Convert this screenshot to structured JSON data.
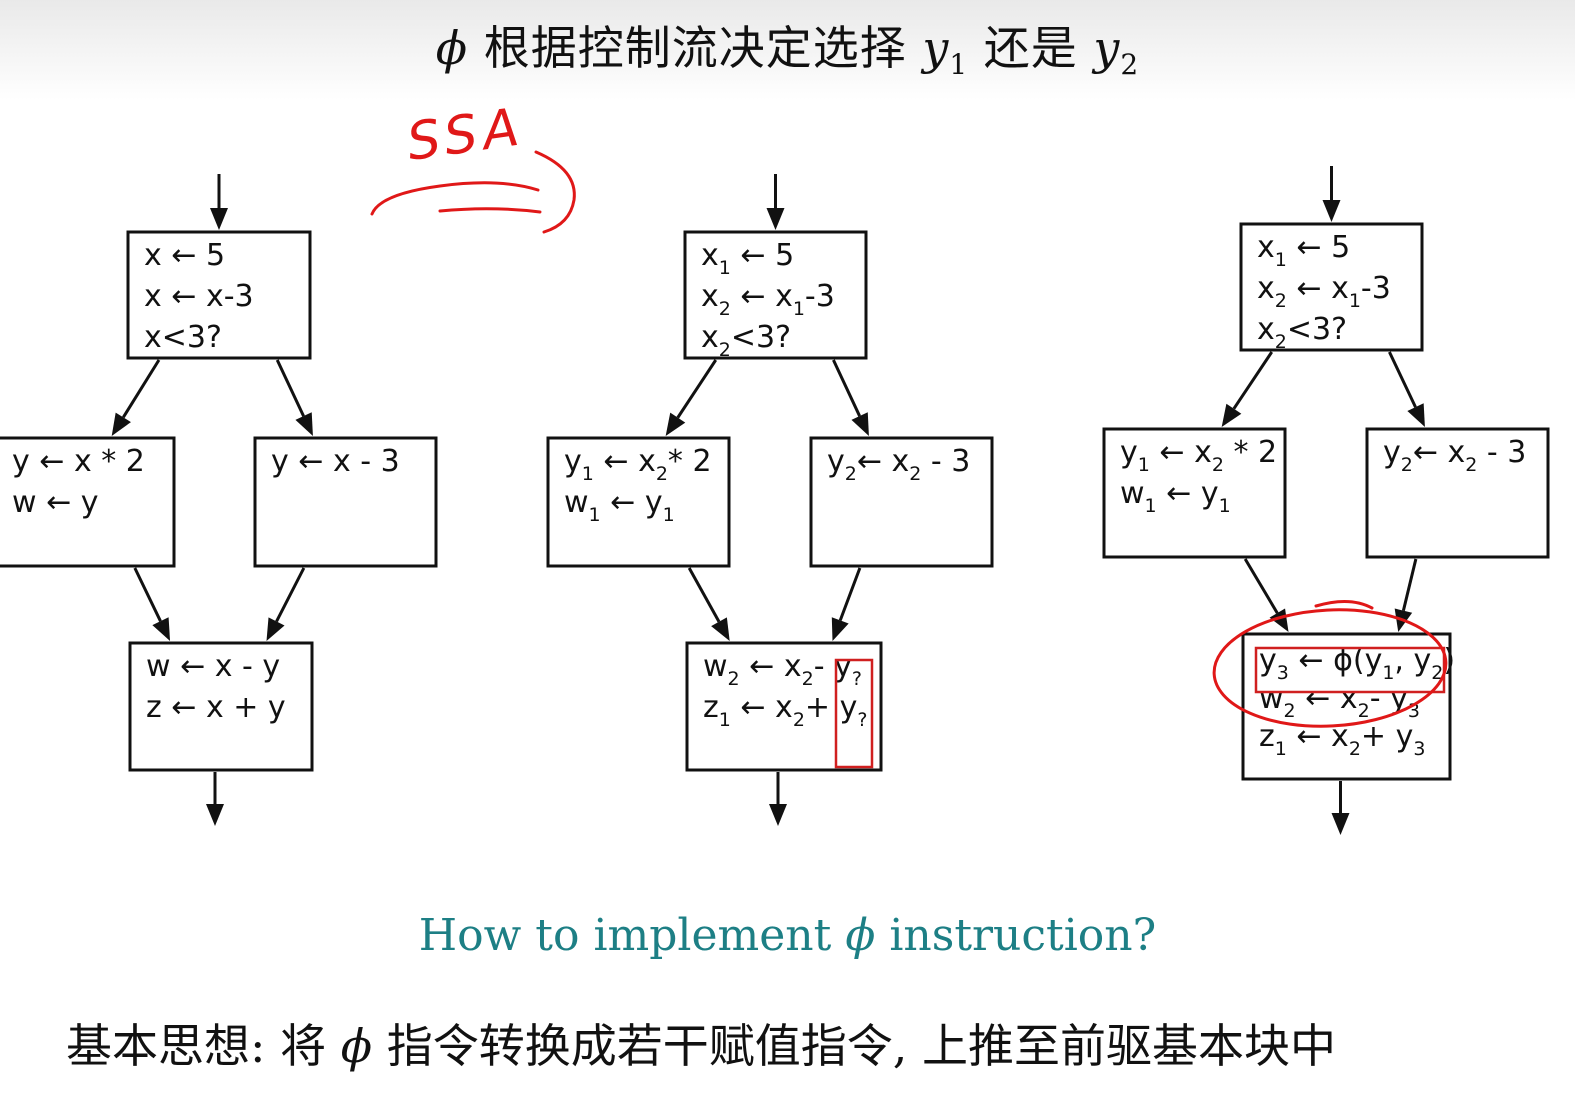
{
  "title": {
    "phi": "ϕ",
    "text": "根据控制流决定选择",
    "y": "y",
    "one": "1",
    "middle": "还是",
    "two": "2"
  },
  "annotation": {
    "ssa_label": "SSA"
  },
  "cfgs": [
    {
      "entry": [
        [
          {
            "t": "x"
          },
          {
            "t": " ← 5"
          }
        ],
        [
          {
            "t": "x"
          },
          {
            "t": " ← x-3"
          }
        ],
        [
          {
            "t": "  x<3?"
          }
        ]
      ],
      "left": [
        [
          {
            "t": "y ← x * 2"
          }
        ],
        [
          {
            "t": "w ← y"
          }
        ]
      ],
      "right": [
        [
          {
            "t": "y ← x - 3"
          }
        ]
      ],
      "join": [
        [
          {
            "t": "w ← x - y"
          }
        ],
        [
          {
            "t": " z ← x + y"
          }
        ]
      ]
    },
    {
      "entry": [
        [
          {
            "t": "x"
          },
          {
            "s": "1"
          },
          {
            "t": " ← 5"
          }
        ],
        [
          {
            "t": "x"
          },
          {
            "s": "2"
          },
          {
            "t": " ← x"
          },
          {
            "s": "1"
          },
          {
            "t": "-3"
          }
        ],
        [
          {
            "t": "  x"
          },
          {
            "s": "2"
          },
          {
            "t": "<3?"
          }
        ]
      ],
      "left": [
        [
          {
            "t": "y"
          },
          {
            "s": "1"
          },
          {
            "t": " ← x"
          },
          {
            "s": "2"
          },
          {
            "t": "* 2"
          }
        ],
        [
          {
            "t": "w"
          },
          {
            "s": "1"
          },
          {
            "t": " ← y"
          },
          {
            "s": "1"
          }
        ]
      ],
      "right": [
        [
          {
            "t": "y"
          },
          {
            "s": "2"
          },
          {
            "t": "← x"
          },
          {
            "s": "2"
          },
          {
            "t": " - 3"
          }
        ]
      ],
      "join": [
        [
          {
            "t": "w"
          },
          {
            "s": "2"
          },
          {
            "t": " ← x"
          },
          {
            "s": "2"
          },
          {
            "t": "- y"
          },
          {
            "s": "?"
          }
        ],
        [
          {
            "t": " z"
          },
          {
            "s": "1"
          },
          {
            "t": " ← x"
          },
          {
            "s": "2"
          },
          {
            "t": "+ y"
          },
          {
            "s": "?"
          }
        ]
      ]
    },
    {
      "entry": [
        [
          {
            "t": "x"
          },
          {
            "s": "1"
          },
          {
            "t": " ← 5"
          }
        ],
        [
          {
            "t": "x"
          },
          {
            "s": "2"
          },
          {
            "t": " ← x"
          },
          {
            "s": "1"
          },
          {
            "t": "-3"
          }
        ],
        [
          {
            "t": "  x"
          },
          {
            "s": "2"
          },
          {
            "t": "<3?"
          }
        ]
      ],
      "left": [
        [
          {
            "t": "y"
          },
          {
            "s": "1"
          },
          {
            "t": " ← x"
          },
          {
            "s": "2"
          },
          {
            "t": " * 2"
          }
        ],
        [
          {
            "t": "w"
          },
          {
            "s": "1"
          },
          {
            "t": " ← y"
          },
          {
            "s": "1"
          }
        ]
      ],
      "right": [
        [
          {
            "t": "y"
          },
          {
            "s": "2"
          },
          {
            "t": "← x"
          },
          {
            "s": "2"
          },
          {
            "t": " - 3"
          }
        ]
      ],
      "join": [
        [
          {
            "t": "y"
          },
          {
            "s": "3"
          },
          {
            "t": " ← ϕ(y"
          },
          {
            "s": "1"
          },
          {
            "t": ", y"
          },
          {
            "s": "2"
          },
          {
            "t": ")"
          }
        ],
        [
          {
            "t": "w"
          },
          {
            "s": "2"
          },
          {
            "t": " ← x"
          },
          {
            "s": "2"
          },
          {
            "t": "- y"
          },
          {
            "s": "3"
          }
        ],
        [
          {
            "t": " z"
          },
          {
            "s": "1"
          },
          {
            "t": " ← x"
          },
          {
            "s": "2"
          },
          {
            "t": "+ y"
          },
          {
            "s": "3"
          }
        ]
      ]
    }
  ],
  "question": {
    "before": "How to implement",
    "phi": "ϕ",
    "after": "instruction?"
  },
  "idea": {
    "before": "基本思想: 将",
    "phi": "ϕ",
    "after": "指令转换成若干赋值指令, 上推至前驱基本块中"
  },
  "colors": {
    "highlight": "#d02020",
    "handwriting": "#e01818",
    "question": "#1d7f85"
  }
}
